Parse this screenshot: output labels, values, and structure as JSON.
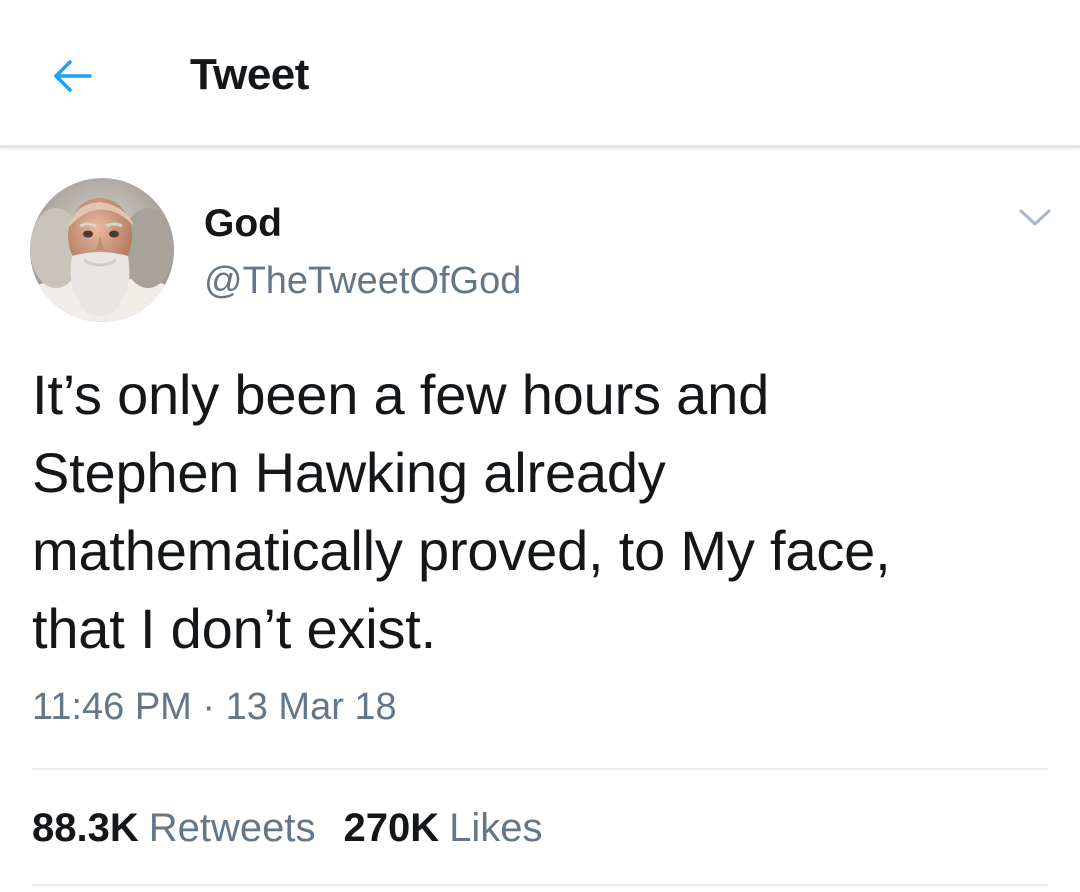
{
  "header": {
    "back_icon": "arrow-left-icon",
    "title": "Tweet",
    "accent_color": "#1da1f2"
  },
  "tweet": {
    "author": {
      "display_name": "God",
      "handle": "@TheTweetOfGod",
      "avatar": "bearded-old-man-avatar"
    },
    "menu_icon": "chevron-down-icon",
    "text_lines": [
      "It’s only been a few hours and",
      "Stephen Hawking already",
      "mathematically proved, to My face,",
      "that I don’t exist."
    ],
    "timestamp": "11:46 PM · 13 Mar 18",
    "stats": {
      "retweets_count": "88.3K",
      "retweets_label": "Retweets",
      "likes_count": "270K",
      "likes_label": "Likes"
    }
  }
}
